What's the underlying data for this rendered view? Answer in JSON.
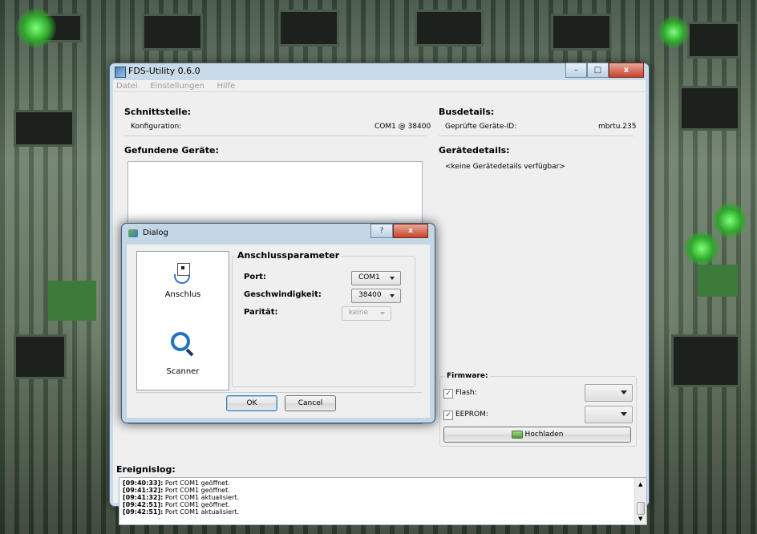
{
  "window": {
    "title": "FDS-Utility 0.6.0"
  },
  "menu": [
    "Datei",
    "Einstellungen",
    "Hilfe"
  ],
  "schnittstelle": {
    "heading": "Schnittstelle:",
    "konfiguration_label": "Konfiguration:",
    "konfiguration_value": "COM1 @ 38400"
  },
  "busdetails": {
    "heading": "Busdetails:",
    "label": "Geprüfte Geräte-ID:",
    "value": "mbrtu.235"
  },
  "gefundene_geraete": {
    "heading": "Gefundene Geräte:"
  },
  "geraetedetails": {
    "heading": "Gerätedetails:",
    "text": "<keine Gerätedetails verfügbar>"
  },
  "firmware": {
    "heading": "Firmware:",
    "flash_label": "Flash:",
    "eeprom_label": "EEPROM:",
    "upload_label": "Hochladen"
  },
  "ereignislog": {
    "heading": "Ereignislog:",
    "lines": [
      {
        "time": "[09:40:33]:",
        "msg": " Port COM1 geöffnet."
      },
      {
        "time": "[09:41:32]:",
        "msg": " Port COM1 geöffnet."
      },
      {
        "time": "[09:41:32]:",
        "msg": " Port COM1 aktualisiert."
      },
      {
        "time": "[09:42:51]:",
        "msg": " Port COM1 geöffnet."
      },
      {
        "time": "[09:42:51]:",
        "msg": " Port COM1 aktualisiert."
      }
    ]
  },
  "dialog": {
    "title": "Dialog",
    "help": "?",
    "close": "x",
    "pages": [
      "Anschlus",
      "Scanner"
    ],
    "group_title": "Anschlussparameter",
    "port_label": "Port:",
    "port_value": "COM1",
    "speed_label": "Geschwindigkeit:",
    "speed_value": "38400",
    "parity_label": "Parität:",
    "parity_value": "keine",
    "ok_label": "OK",
    "cancel_label": "Cancel"
  }
}
